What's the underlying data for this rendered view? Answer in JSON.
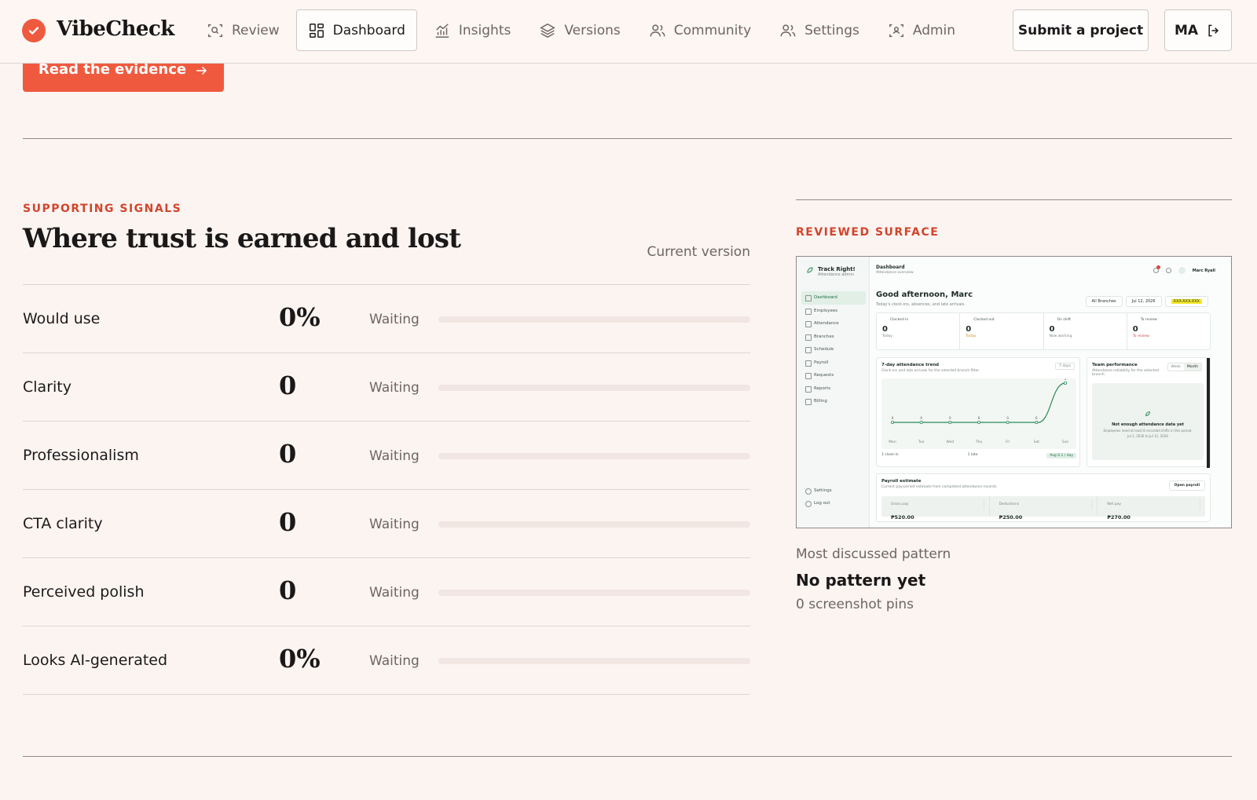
{
  "nav": {
    "brand": "VibeCheck",
    "links": [
      {
        "label": "Review",
        "icon": "scan-search-icon"
      },
      {
        "label": "Dashboard",
        "icon": "grid-icon",
        "active": true
      },
      {
        "label": "Insights",
        "icon": "bar-chart-icon"
      },
      {
        "label": "Versions",
        "icon": "layers-icon"
      },
      {
        "label": "Community",
        "icon": "users-icon"
      },
      {
        "label": "Settings",
        "icon": "user-settings-icon"
      },
      {
        "label": "Admin",
        "icon": "scan-user-icon"
      }
    ],
    "submit_label": "Submit a project",
    "user_initials": "MA"
  },
  "evidence_cta": "Read the evidence",
  "signals": {
    "eyebrow": "SUPPORTING SIGNALS",
    "title": "Where trust is earned and lost",
    "version_label": "Current version",
    "rows": [
      {
        "label": "Would use",
        "value": "0%",
        "status": "Waiting",
        "level": 0
      },
      {
        "label": "Clarity",
        "value": "0",
        "status": "Waiting",
        "level": 0
      },
      {
        "label": "Professionalism",
        "value": "0",
        "status": "Waiting",
        "level": 0
      },
      {
        "label": "CTA clarity",
        "value": "0",
        "status": "Waiting",
        "level": 0
      },
      {
        "label": "Perceived polish",
        "value": "0",
        "status": "Waiting",
        "level": 0
      },
      {
        "label": "Looks AI-generated",
        "value": "0%",
        "status": "Waiting",
        "level": 0
      }
    ]
  },
  "surface": {
    "eyebrow": "REVIEWED SURFACE",
    "pattern_caption": "Most discussed pattern",
    "pattern_title": "No pattern yet",
    "pattern_pins": "0 screenshot pins"
  },
  "preview": {
    "app_name": "Track Right!",
    "app_sub": "Attendance admin",
    "nav": [
      "Dashboard",
      "Employees",
      "Attendance",
      "Branches",
      "Schedule",
      "Payroll",
      "Requests",
      "Reports",
      "Billing"
    ],
    "footer_nav": [
      "Settings",
      "Log out"
    ],
    "page_title": "Dashboard",
    "page_sub": "Attendance overview",
    "user_name": "Marc Ryall",
    "greeting": "Good afternoon, Marc",
    "greeting_sub": "Today's clock-ins, absences, and late arrivals.",
    "filters": {
      "branch": "All Branches",
      "date": "Jul 12, 2026",
      "code": "XXX-XXX-XXX"
    },
    "stats": [
      {
        "label": "Clocked in",
        "value": "0",
        "sub": "Today"
      },
      {
        "label": "Clocked out",
        "value": "0",
        "sub": "Today"
      },
      {
        "label": "On shift",
        "value": "0",
        "sub": "Now working"
      },
      {
        "label": "To review",
        "value": "0",
        "sub": "To review"
      }
    ],
    "trend": {
      "title": "7-day attendance trend",
      "sub": "Clock-ins and late arrivals for the selected branch filter.",
      "range": "7 days",
      "days": [
        "Mon",
        "Tue",
        "Wed",
        "Thu",
        "Fri",
        "Sat",
        "Sun"
      ],
      "values": [
        0,
        0,
        0,
        0,
        0,
        0,
        1
      ],
      "legend": [
        "1 clock-in",
        "1 late",
        "Avg 0.1 / day"
      ]
    },
    "team": {
      "title": "Team performance",
      "sub": "Attendance reliability for the selected branch.",
      "toggles": [
        "Week",
        "Month"
      ],
      "empty_title": "Not enough attendance data yet",
      "empty_sub": "Employees need at least 8 recorded shifts in this period.",
      "empty_range": "Jul 1, 2026 to Jul 12, 2026"
    },
    "payroll": {
      "title": "Payroll estimate",
      "sub": "Current pay-period estimate from completed attendance records.",
      "button": "Open payroll",
      "cells": [
        {
          "label": "Gross pay",
          "value": "₱520.00"
        },
        {
          "label": "Deductions",
          "value": "₱250.00"
        },
        {
          "label": "Net pay",
          "value": "₱270.00"
        }
      ]
    }
  }
}
